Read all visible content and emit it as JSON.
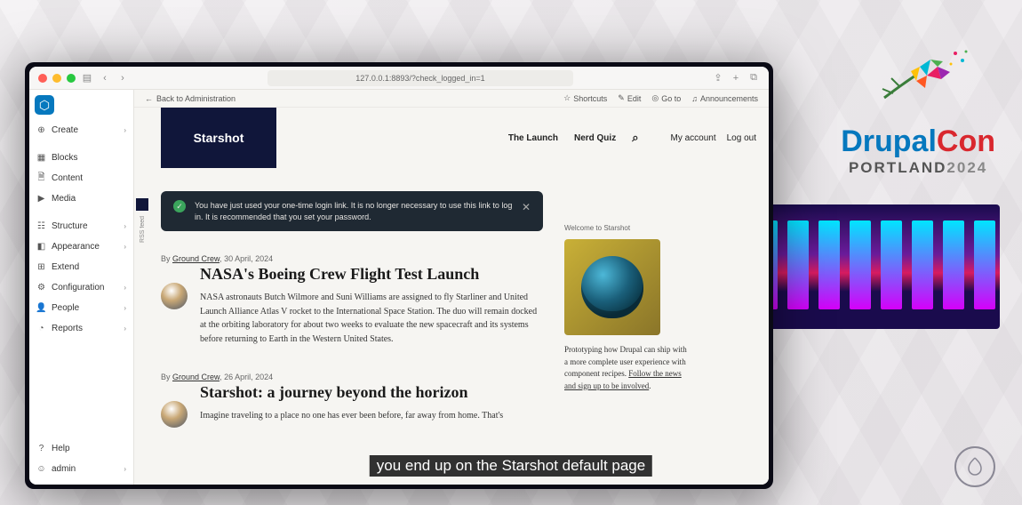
{
  "browser": {
    "url": "127.0.0.1:8893/?check_logged_in=1"
  },
  "admin_toolbar": {
    "back": "Back to Administration",
    "shortcuts": "Shortcuts",
    "edit": "Edit",
    "goto": "Go to",
    "announcements": "Announcements"
  },
  "sidebar": {
    "create": "Create",
    "blocks": "Blocks",
    "content": "Content",
    "media": "Media",
    "structure": "Structure",
    "appearance": "Appearance",
    "extend": "Extend",
    "configuration": "Configuration",
    "people": "People",
    "reports": "Reports",
    "help": "Help",
    "admin": "admin"
  },
  "site": {
    "name": "Starshot",
    "nav": {
      "launch": "The Launch",
      "quiz": "Nerd Quiz"
    },
    "account": "My account",
    "logout": "Log out",
    "rss": "RSS feed"
  },
  "alert": {
    "text": "You have just used your one-time login link. It is no longer necessary to use this link to log in. It is recommended that you set your password."
  },
  "articles": [
    {
      "author": "Ground Crew",
      "date": "30 April, 2024",
      "title": "NASA's Boeing Crew Flight Test Launch",
      "body": "NASA astronauts Butch Wilmore and Suni Williams are assigned to fly Starliner and United Launch Alliance Atlas V rocket to the International Space Station. The duo will remain docked at the orbiting laboratory for about two weeks to evaluate the new spacecraft and its systems before returning to Earth in the Western United States."
    },
    {
      "author": "Ground Crew",
      "date": "26 April, 2024",
      "title": "Starshot: a journey beyond the horizon",
      "body": "Imagine traveling to a place no one has ever been before, far away from home. That's"
    }
  ],
  "aside": {
    "welcome": "Welcome to Starshot",
    "text_a": "Prototyping how Drupal can ship with a more complete user experience with com­ponent recipes. ",
    "link_a": "Follow the news and sign up to be in­volved",
    "text_b": "."
  },
  "caption": "you end up on the Starshot default page",
  "conference": {
    "a": "Drupal",
    "b": "Con",
    "sub_a": "PORTLAND",
    "sub_b": "2024"
  }
}
